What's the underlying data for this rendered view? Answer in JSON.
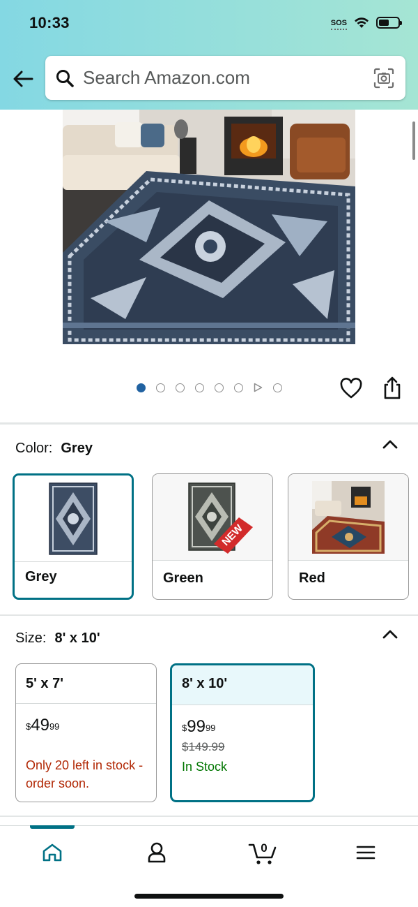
{
  "status_bar": {
    "time": "10:33",
    "sos": "SOS"
  },
  "search": {
    "placeholder": "Search Amazon.com"
  },
  "colors": {
    "accent": "#007185",
    "deal_red": "#b12704",
    "in_stock_green": "#007600",
    "dot_active": "#2162a1"
  },
  "gallery": {
    "total_images": 7,
    "has_video": true,
    "active_index": 0
  },
  "color_section": {
    "label": "Color:",
    "selected": "Grey",
    "options": [
      {
        "name": "Grey",
        "badge": ""
      },
      {
        "name": "Green",
        "badge": "NEW"
      },
      {
        "name": "Red",
        "badge": ""
      }
    ]
  },
  "size_section": {
    "label": "Size:",
    "selected": "8' x 10'",
    "options": [
      {
        "size": "5' x 7'",
        "price_symbol": "$",
        "price_whole": "49",
        "price_fraction": "99",
        "list_price": "",
        "availability": "Only 20 left in stock - order soon."
      },
      {
        "size": "8' x 10'",
        "price_symbol": "$",
        "price_whole": "99",
        "price_fraction": "99",
        "list_price": "$149.99",
        "availability": "In Stock"
      }
    ]
  },
  "tab_bar": {
    "items": [
      "home-icon",
      "account-icon",
      "cart-icon",
      "menu-icon"
    ],
    "cart_count": "0",
    "active": "home"
  }
}
